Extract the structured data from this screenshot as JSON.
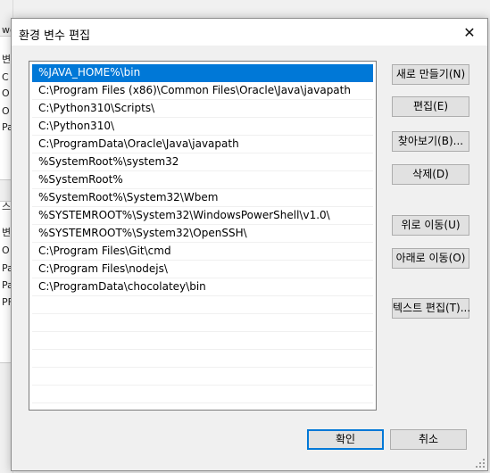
{
  "background_window": {
    "fragments": [
      "wo",
      "변",
      "C",
      "O",
      "O",
      "Pa",
      "스",
      "변",
      "O",
      "Pa",
      "Pa",
      "PF"
    ]
  },
  "dialog": {
    "title": "환경 변수 편집",
    "close_glyph": "✕",
    "list_items": [
      "%JAVA_HOME%\\bin",
      "C:\\Program Files (x86)\\Common Files\\Oracle\\Java\\javapath",
      "C:\\Python310\\Scripts\\",
      "C:\\Python310\\",
      "C:\\ProgramData\\Oracle\\Java\\javapath",
      "%SystemRoot%\\system32",
      "%SystemRoot%",
      "%SystemRoot%\\System32\\Wbem",
      "%SYSTEMROOT%\\System32\\WindowsPowerShell\\v1.0\\",
      "%SYSTEMROOT%\\System32\\OpenSSH\\",
      "C:\\Program Files\\Git\\cmd",
      "C:\\Program Files\\nodejs\\",
      "C:\\ProgramData\\chocolatey\\bin"
    ],
    "selected_index": 0,
    "buttons": {
      "new": "새로 만들기(N)",
      "edit": "편집(E)",
      "browse": "찾아보기(B)...",
      "delete": "삭제(D)",
      "move_up": "위로 이동(U)",
      "move_down": "아래로 이동(O)",
      "edit_text": "텍스트 편집(T)...",
      "ok": "확인",
      "cancel": "취소"
    }
  },
  "colors": {
    "selection": "#0078d7",
    "button_face": "#e1e1e1",
    "dialog_bg": "#f0f0f0"
  }
}
